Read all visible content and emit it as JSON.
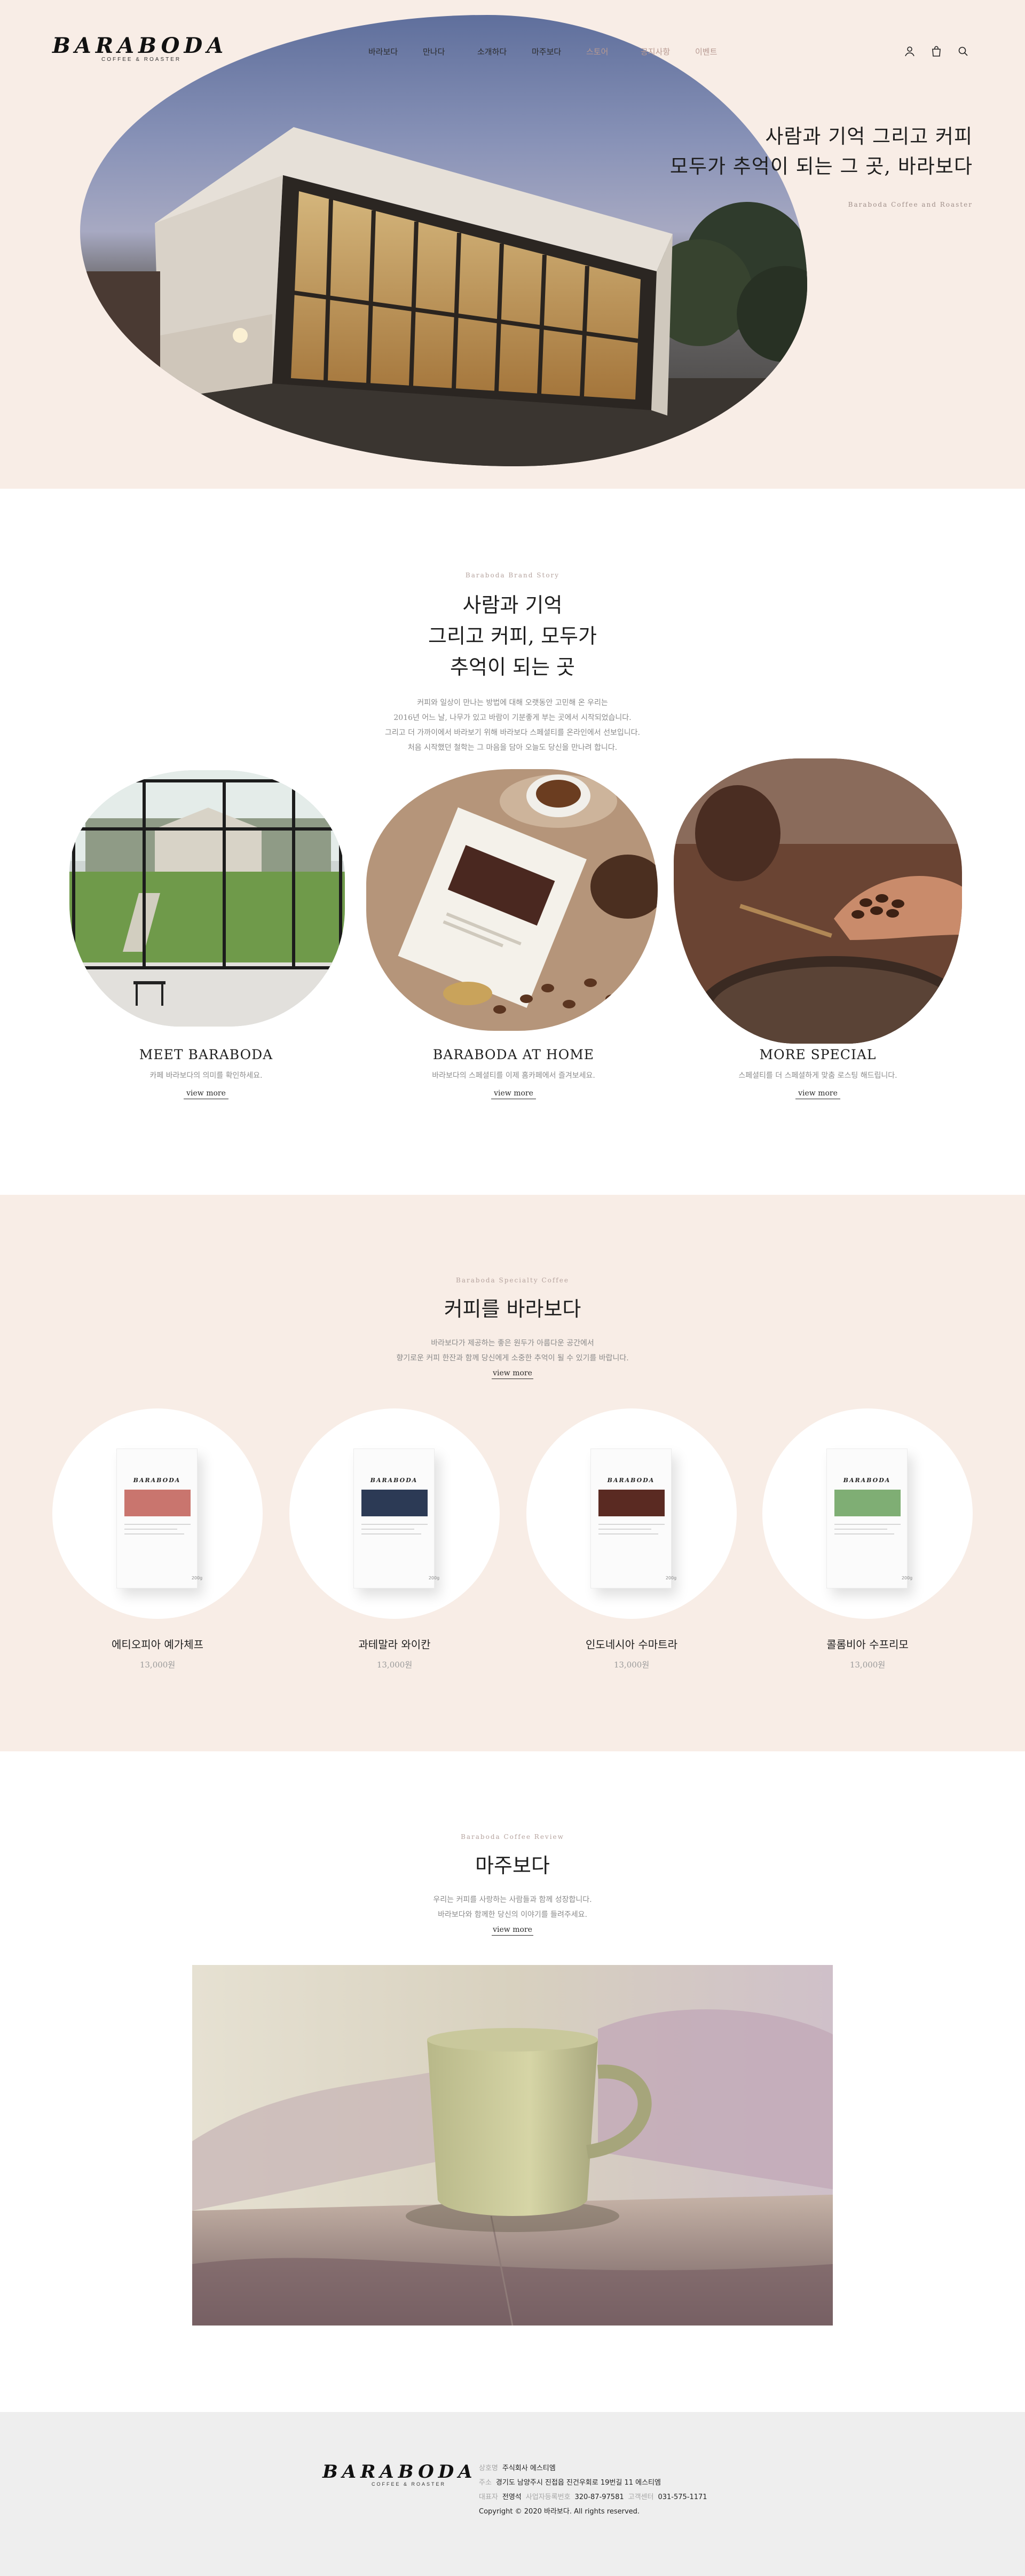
{
  "brand": {
    "wordmark": "BARABODA",
    "tagline": "COFFEE & ROASTER"
  },
  "nav": {
    "items": [
      "바라보다",
      "만나다",
      "소개하다",
      "마주보다",
      "스토어",
      "공지사항",
      "이벤트"
    ]
  },
  "util_icons": [
    "user-icon",
    "cart-icon",
    "search-icon"
  ],
  "hero": {
    "line1": "사람과 기억 그리고 커피",
    "line2": "모두가 추억이 되는 그 곳, 바라보다",
    "sub": "Baraboda Coffee and Roaster"
  },
  "story": {
    "eyebrow": "Baraboda Brand Story",
    "title": [
      "사람과 기억",
      "그리고 커피, 모두가",
      "추억이 되는 곳"
    ],
    "desc": [
      "커피와 일상이 만나는 방법에 대해 오랫동안 고민해 온 우리는",
      "2016년 어느 날, 나무가 있고 바람이 기분좋게 부는 곳에서 시작되었습니다.",
      "그리고 더 가까이에서 바라보기 위해 바라보다 스페셜티를 온라인에서 선보입니다.",
      "처음 시작했던 철학는 그 마음을 담아 오늘도 당신을 만나려 합니다."
    ],
    "cards": [
      {
        "title": "MEET BARABODA",
        "desc": "카페 바라보다의 의미를 확인하세요.",
        "more": "view more"
      },
      {
        "title": "BARABODA AT HOME",
        "desc": "바라보다의 스페셜티를 이제 홈카페에서 즐겨보세요.",
        "more": "view more"
      },
      {
        "title": "MORE SPECIAL",
        "desc": "스페셜티를 더 스페셜하게 맞춤 로스팅 해드립니다.",
        "more": "view more"
      }
    ]
  },
  "products": {
    "eyebrow": "Baraboda Specialty Coffee",
    "title": "커피를 바라보다",
    "desc": [
      "바라보다가 제공하는 좋은 원두가 아름다운 공간에서",
      "향기로운 커피 한잔과 함께 당신에게 소중한 추억이 될 수 있기를 바랍니다."
    ],
    "more": "view more",
    "items": [
      {
        "name": "에티오피아 예가체프",
        "price": "13,000원",
        "label_color": "#c9756e",
        "bag_weight": "200g"
      },
      {
        "name": "과테말라 와이칸",
        "price": "13,000원",
        "label_color": "#2c3a55",
        "bag_weight": "200g"
      },
      {
        "name": "인도네시아 수마트라",
        "price": "13,000원",
        "label_color": "#5a2a22",
        "bag_weight": "200g"
      },
      {
        "name": "콜롬비아 수프리모",
        "price": "13,000원",
        "label_color": "#7fae74",
        "bag_weight": "200g"
      }
    ]
  },
  "review": {
    "eyebrow": "Baraboda Coffee Review",
    "title": "마주보다",
    "desc": [
      "우리는 커피를 사랑하는 사람들과 함께 성장합니다.",
      "바라보다와 함께한 당신의 이야기를 들려주세요."
    ],
    "more": "view more"
  },
  "footer": {
    "company_k": "상호명",
    "company_v": "주식회사 에스티엠",
    "address_k": "주소",
    "address_v": "경기도 남양주시 진접읍 진건우회로 19번길 11 에스티엠",
    "ceo_k": "대표자",
    "ceo_v": "전영석",
    "biz_k": "사업자등록번호",
    "biz_v": "320-87-97581",
    "tel_k": "고객센터",
    "tel_v": "031-575-1171",
    "copyright": "Copyright © 2020 바라보다. All rights reserved."
  },
  "colors": {
    "accent_bg": "#f8ede6",
    "footer_bg": "#eeeeee",
    "muted_text": "#8a8a8a",
    "nav_dim": "#b89a92"
  }
}
